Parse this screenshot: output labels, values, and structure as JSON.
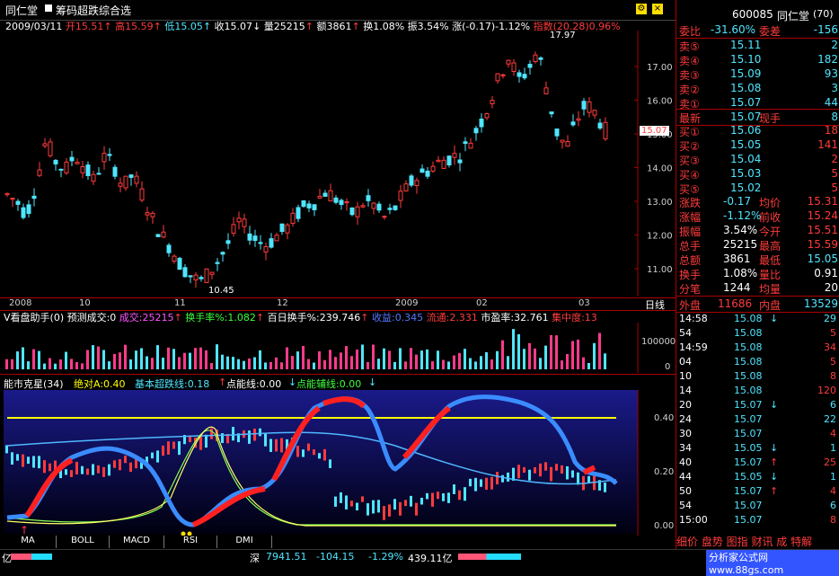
{
  "header": {
    "stock_name": "同仁堂",
    "indicator_title": "筹码超跌综合选"
  },
  "ohlc": {
    "date": "2009/03/11",
    "open": "开15.51",
    "high": "高15.59",
    "low": "低15.05",
    "close": "收15.07",
    "volume": "量25215",
    "amount": "额3861",
    "turnover": "换1.08%",
    "amplitude": "振3.54%",
    "change": "涨(-0.17)-1.12%",
    "index_label": "指数(20.28)0.96%"
  },
  "price_chart": {
    "y_ticks": [
      "17.00",
      "16.00",
      "15.00",
      "14.00",
      "13.00",
      "12.00",
      "11.00"
    ],
    "current_price_tag": "15.07",
    "high_marker": "17.97",
    "low_marker": "10.45",
    "x_labels": [
      "2008",
      "10",
      "11",
      "12",
      "2009",
      "02",
      "03"
    ],
    "period": "日线"
  },
  "volume_panel": {
    "title": "V看盘助手(0) 预测成交:0",
    "items": [
      {
        "label": "成交:25215",
        "arrow": "↑"
      },
      {
        "label": "换手率%:1.082",
        "arrow": "↑"
      },
      {
        "label": "百日换手%:239.746",
        "arrow": "↑"
      },
      {
        "label": "收益:0.345",
        "arrow": ""
      },
      {
        "label": "流通:2.331",
        "arrow": ""
      },
      {
        "label": "市盈率:32.761",
        "arrow": ""
      },
      {
        "label": "集中度:13",
        "arrow": ""
      }
    ],
    "y_ticks": [
      "100000",
      "0"
    ]
  },
  "energy_panel": {
    "title": "能市克星(34)",
    "items": [
      {
        "label": "绝对A:0.40"
      },
      {
        "label": "基本超跌线:0.18",
        "arrow": "↑"
      },
      {
        "label": "点能线:0.00",
        "arrow": "↓"
      },
      {
        "label": "点能辅线:0.00",
        "arrow": "↓"
      }
    ],
    "y_ticks": [
      "0.40",
      "0.20",
      "0.00"
    ]
  },
  "tabs": [
    "MA",
    "BOLL",
    "MACD",
    "RSI",
    "DMI"
  ],
  "quote": {
    "code": "600085",
    "name": "同仁堂",
    "count": "(70)",
    "webi_label": "委比",
    "webi_value": "-31.60%",
    "weicha_label": "委差",
    "weicha_value": "-156",
    "sells": [
      {
        "label": "卖⑤",
        "price": "15.11",
        "vol": "2"
      },
      {
        "label": "卖④",
        "price": "15.10",
        "vol": "182"
      },
      {
        "label": "卖③",
        "price": "15.09",
        "vol": "93"
      },
      {
        "label": "卖②",
        "price": "15.08",
        "vol": "3"
      },
      {
        "label": "卖①",
        "price": "15.07",
        "vol": "44"
      }
    ],
    "latest_label": "最新",
    "latest_value": "15.07",
    "xianshou_label": "现手",
    "xianshou_value": "8",
    "buys": [
      {
        "label": "买①",
        "price": "15.06",
        "vol": "18"
      },
      {
        "label": "买②",
        "price": "15.05",
        "vol": "141"
      },
      {
        "label": "买③",
        "price": "15.04",
        "vol": "2"
      },
      {
        "label": "买④",
        "price": "15.03",
        "vol": "5"
      },
      {
        "label": "买⑤",
        "price": "15.02",
        "vol": "5"
      }
    ],
    "stats": [
      {
        "l1": "涨跌",
        "v1": "-0.17",
        "l2": "均价",
        "v2": "15.31"
      },
      {
        "l1": "涨幅",
        "v1": "-1.12%",
        "l2": "前收",
        "v2": "15.24"
      },
      {
        "l1": "振幅",
        "v1": "3.54%",
        "l2": "今开",
        "v2": "15.51"
      },
      {
        "l1": "总手",
        "v1": "25215",
        "l2": "最高",
        "v2": "15.59"
      },
      {
        "l1": "总额",
        "v1": "3861",
        "l2": "最低",
        "v2": "15.05"
      },
      {
        "l1": "换手",
        "v1": "1.08%",
        "l2": "量比",
        "v2": "0.91"
      },
      {
        "l1": "分笔",
        "v1": "1244",
        "l2": "均量",
        "v2": "20"
      }
    ],
    "waipan_label": "外盘",
    "waipan_value": "11686",
    "neipan_label": "内盘",
    "neipan_value": "13529"
  },
  "ticks": [
    {
      "time": "14:58",
      "price": "15.08",
      "arrow": "↓",
      "vol": "29"
    },
    {
      "time": "54",
      "price": "15.08",
      "arrow": "",
      "vol": "5"
    },
    {
      "time": "14:59",
      "price": "15.08",
      "arrow": "",
      "vol": "34"
    },
    {
      "time": "04",
      "price": "15.08",
      "arrow": "",
      "vol": "5"
    },
    {
      "time": "10",
      "price": "15.08",
      "arrow": "",
      "vol": "8"
    },
    {
      "time": "14",
      "price": "15.08",
      "arrow": "",
      "vol": "120"
    },
    {
      "time": "20",
      "price": "15.07",
      "arrow": "↓",
      "vol": "6"
    },
    {
      "time": "24",
      "price": "15.07",
      "arrow": "",
      "vol": "22"
    },
    {
      "time": "30",
      "price": "15.07",
      "arrow": "",
      "vol": "4"
    },
    {
      "time": "34",
      "price": "15.05",
      "arrow": "↓",
      "vol": "1"
    },
    {
      "time": "40",
      "price": "15.07",
      "arrow": "↑",
      "vol": "25"
    },
    {
      "time": "44",
      "price": "15.05",
      "arrow": "↓",
      "vol": "1"
    },
    {
      "time": "50",
      "price": "15.07",
      "arrow": "↑",
      "vol": "4"
    },
    {
      "time": "54",
      "price": "15.07",
      "arrow": "",
      "vol": "6"
    },
    {
      "time": "15:00",
      "price": "15.07",
      "arrow": "",
      "vol": "8"
    }
  ],
  "info_bar": "细价 盘势 图指 财讯 成 特解",
  "status_bar": {
    "left": "亿",
    "index_name": "深",
    "index_value": "7941.51",
    "index_change": "-104.15",
    "index_pct": "-1.29%",
    "index_amount": "439.11亿",
    "site": "分析家公式网 www.88gs.com"
  }
}
